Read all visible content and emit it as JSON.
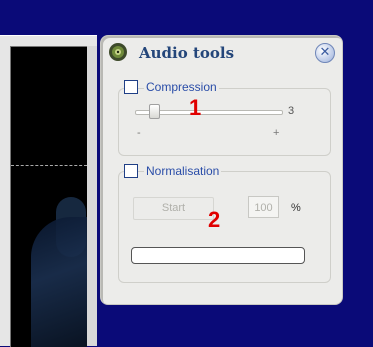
{
  "panel": {
    "title": "Audio tools",
    "compression": {
      "label": "Compression",
      "checked": false,
      "slider_value": "3",
      "slider_fraction": 0.1,
      "tick_min": "-",
      "tick_max": "+"
    },
    "normalisation": {
      "label": "Normalisation",
      "checked": false,
      "start_label": "Start",
      "percent_value": "100",
      "percent_unit": "%",
      "progress": 0
    }
  },
  "callouts": [
    "1",
    "2"
  ],
  "colors": {
    "background": "#0a0a78",
    "panel": "#ececea",
    "title": "#24467a",
    "label": "#2a4da8",
    "callout": "#e00000"
  }
}
